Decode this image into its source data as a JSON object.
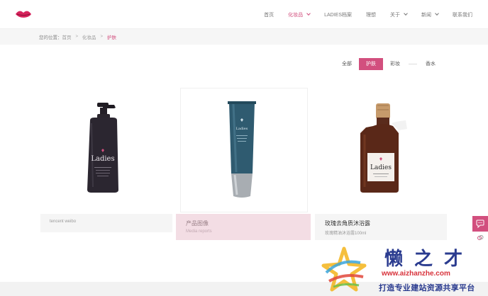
{
  "brand": {
    "logo_icon": "lips-icon",
    "accent": "#d24f7e"
  },
  "nav": {
    "items": [
      {
        "label": "首页",
        "active": false,
        "dropdown": false
      },
      {
        "label": "化妆品",
        "active": true,
        "dropdown": true
      },
      {
        "label": "LADIES档案",
        "active": false,
        "dropdown": false
      },
      {
        "label": "理想",
        "active": false,
        "dropdown": false
      },
      {
        "label": "关于",
        "active": false,
        "dropdown": true
      },
      {
        "label": "新闻",
        "active": false,
        "dropdown": true
      },
      {
        "label": "联系我们",
        "active": false,
        "dropdown": false
      }
    ]
  },
  "breadcrumb": {
    "prefix": "您的位置：",
    "items": [
      "首页",
      "化妆品"
    ],
    "current": "护肤"
  },
  "filters": {
    "items": [
      {
        "label": "全部",
        "active": false
      },
      {
        "label": "护肤",
        "active": true
      },
      {
        "label": "彩妆",
        "active": false
      },
      {
        "label": "香水",
        "active": false
      }
    ]
  },
  "products": [
    {
      "title": "tencent weibo",
      "subtitle": "",
      "brand_text": "Ladies"
    },
    {
      "title": "产品图像",
      "subtitle": "Media reports",
      "brand_text": "Ladies"
    },
    {
      "title": "玫瑰去角质沐浴露",
      "subtitle": "玫瑰精油沐浴露100ml",
      "brand_text": "Ladies"
    }
  ],
  "side_tools": [
    {
      "icon": "chat-bubble-icon"
    },
    {
      "icon": "link-icon"
    }
  ],
  "watermark": {
    "title": "懒之才",
    "url": "www.aizhanzhe.com",
    "slogan": "打造专业建站资源共享平台"
  }
}
